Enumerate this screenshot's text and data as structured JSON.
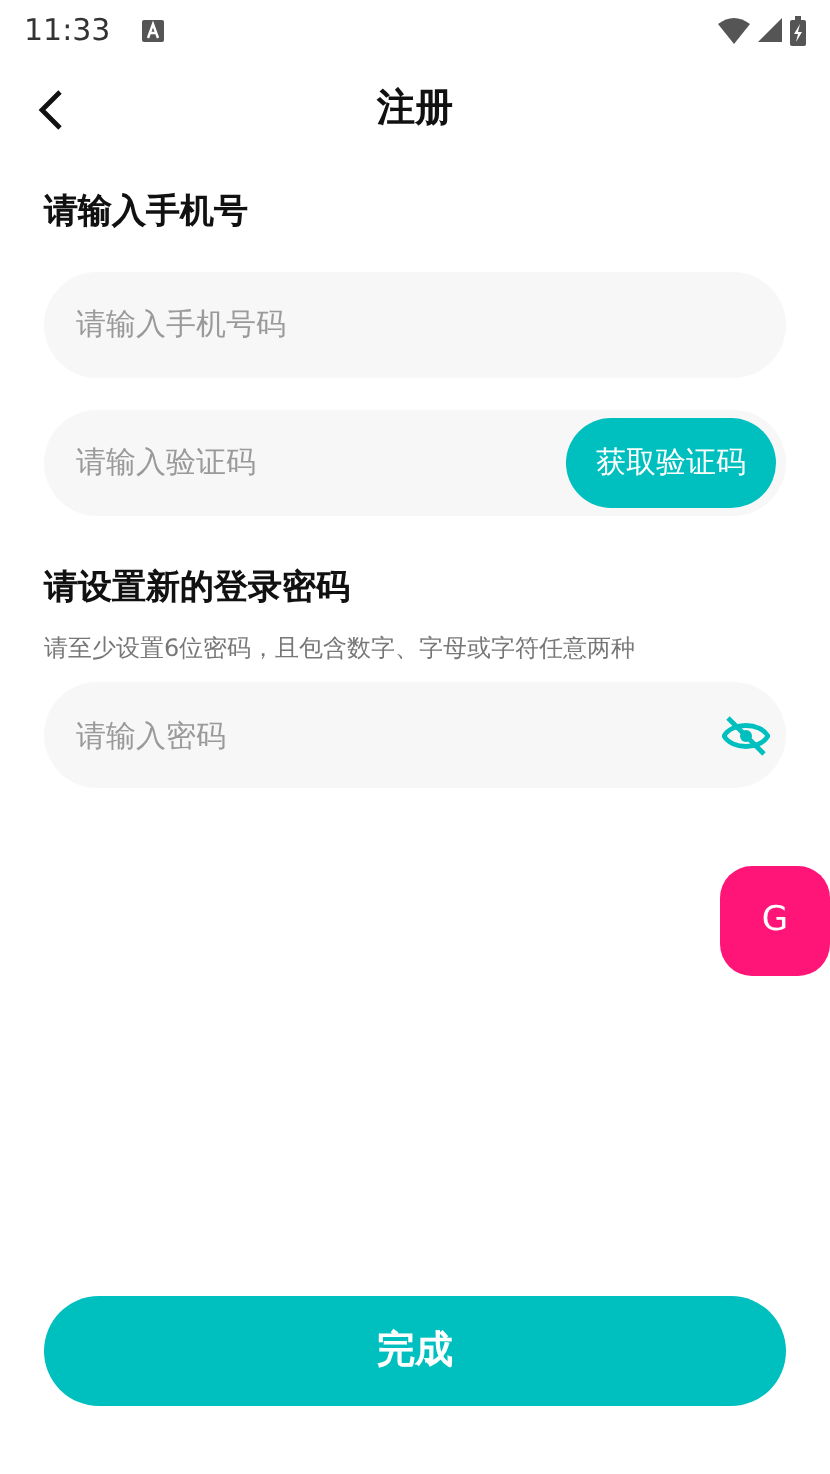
{
  "status_bar": {
    "time": "11:33"
  },
  "header": {
    "title": "注册"
  },
  "phone_section": {
    "title": "请输入手机号",
    "phone_placeholder": "请输入手机号码",
    "code_placeholder": "请输入验证码",
    "code_button": "获取验证码"
  },
  "password_section": {
    "title": "请设置新的登录密码",
    "hint": "请至少设置6位密码，且包含数字、字母或字符任意两种",
    "placeholder": "请输入密码",
    "password_visible": false
  },
  "floating_button": {
    "label": "G"
  },
  "submit_button": "完成"
}
